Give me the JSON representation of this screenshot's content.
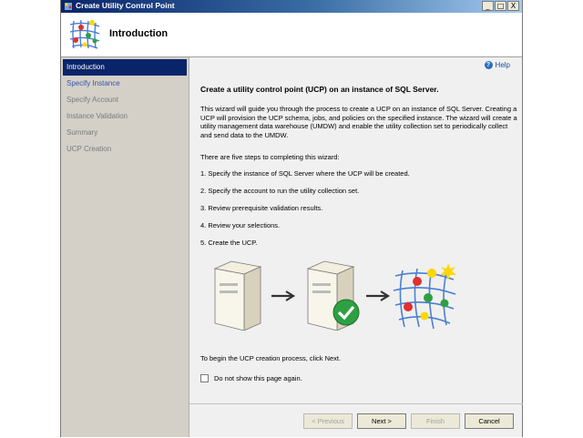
{
  "window": {
    "title": "Create Utility Control Point",
    "controls": {
      "minimize": "_",
      "maximize": "□",
      "close": "X"
    }
  },
  "header": {
    "title": "Introduction"
  },
  "sidebar": {
    "items": [
      {
        "label": "Introduction",
        "state": "active"
      },
      {
        "label": "Specify Instance",
        "state": "link"
      },
      {
        "label": "Specify Account",
        "state": "disabled"
      },
      {
        "label": "Instance Validation",
        "state": "disabled"
      },
      {
        "label": "Summary",
        "state": "disabled"
      },
      {
        "label": "UCP Creation",
        "state": "disabled"
      }
    ]
  },
  "content": {
    "help_label": "Help",
    "heading": "Create a utility control point (UCP) on an instance of SQL Server.",
    "description": "This wizard will guide you through the process to create a UCP on an instance of SQL Server. Creating a UCP will provision the UCP schema, jobs, and policies on the specified instance. The wizard will create a utility management data warehouse (UMDW) and enable the utility collection set to periodically collect and send data to the UMDW.",
    "steps_intro": "There are five steps to completing this wizard:",
    "steps": [
      "1. Specify the instance of SQL Server where the UCP will be created.",
      "2. Specify the account to run the utility collection set.",
      "3. Review prerequisite validation results.",
      "4. Review your selections.",
      "5. Create the UCP."
    ],
    "begin_text": "To begin the UCP creation process, click Next.",
    "checkbox_label": "Do not show this page again.",
    "checkbox_checked": false
  },
  "footer": {
    "previous": "< Previous",
    "next": "Next >",
    "finish": "Finish",
    "cancel": "Cancel"
  },
  "colors": {
    "titlebar": "#0a246a",
    "sidebar_active": "#0a246a",
    "sidebar_bg": "#d4d0c8",
    "checkmark": "#2ea043"
  }
}
